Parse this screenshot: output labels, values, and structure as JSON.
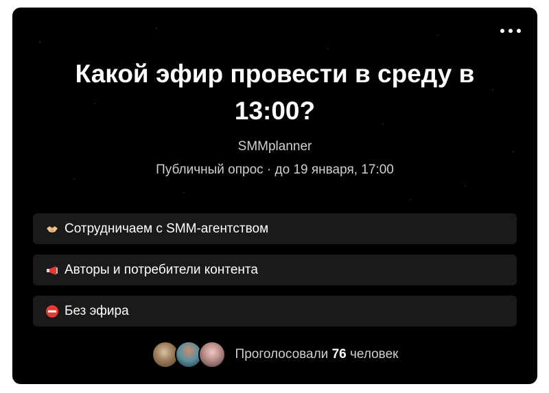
{
  "poll": {
    "title": "Какой эфир провести в среду в 13:00?",
    "author": "SMMplanner",
    "meta": "Публичный опрос · до 19 января, 17:00",
    "options": [
      {
        "icon": "handshake-icon",
        "label": "Сотрудничаем с SMM-агентством"
      },
      {
        "icon": "megaphone-icon",
        "label": "Авторы и потребители контента"
      },
      {
        "icon": "no-entry-icon",
        "label": "Без эфира"
      }
    ],
    "votes": {
      "prefix": "Проголосовали",
      "count": "76",
      "suffix": "человек"
    }
  }
}
